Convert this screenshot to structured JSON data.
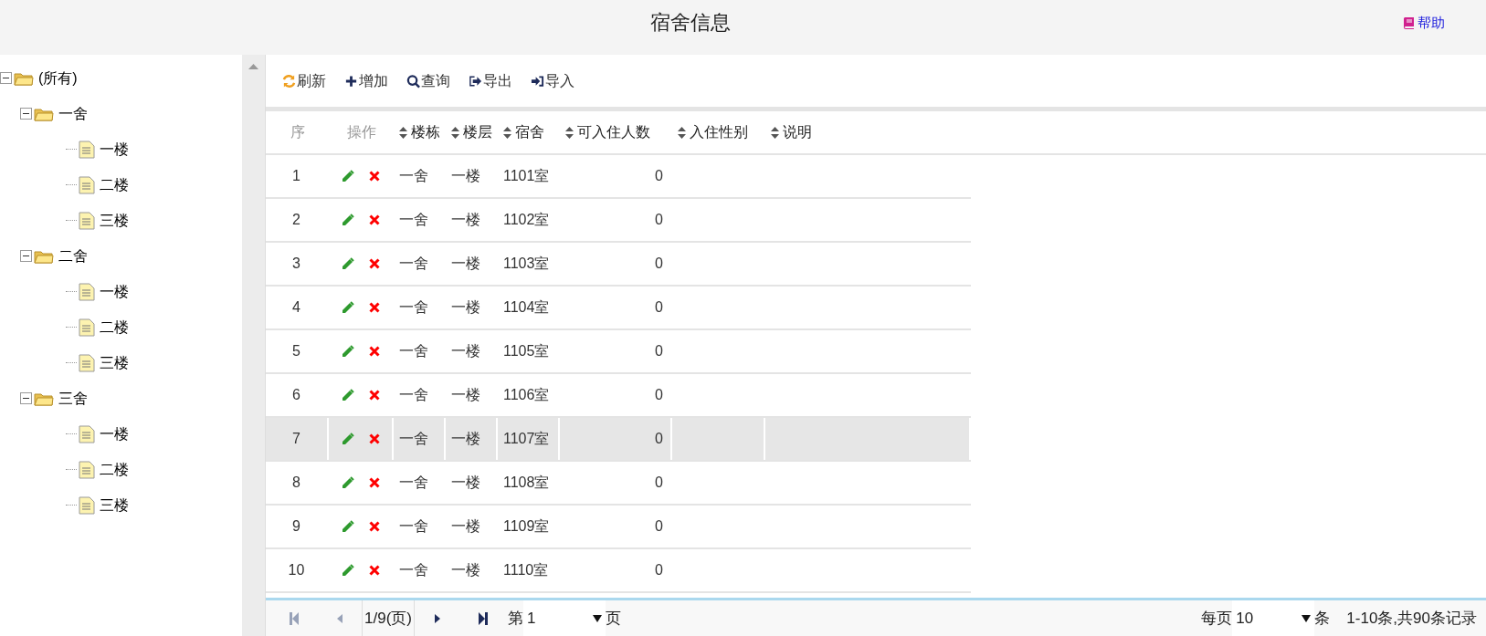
{
  "header": {
    "title": "宿舍信息",
    "help": "帮助"
  },
  "tree": {
    "label": "(所有)",
    "expanded": true,
    "children": [
      {
        "label": "一舍",
        "expanded": true,
        "children": [
          {
            "label": "一楼"
          },
          {
            "label": "二楼"
          },
          {
            "label": "三楼"
          }
        ]
      },
      {
        "label": "二舍",
        "expanded": true,
        "children": [
          {
            "label": "一楼"
          },
          {
            "label": "二楼"
          },
          {
            "label": "三楼"
          }
        ]
      },
      {
        "label": "三舍",
        "expanded": true,
        "children": [
          {
            "label": "一楼"
          },
          {
            "label": "二楼"
          },
          {
            "label": "三楼"
          }
        ]
      }
    ]
  },
  "toolbar": [
    {
      "kind": "refresh",
      "label": "刷新"
    },
    {
      "kind": "add",
      "label": "增加"
    },
    {
      "kind": "search",
      "label": "查询"
    },
    {
      "kind": "export",
      "label": "导出"
    },
    {
      "kind": "import",
      "label": "导入"
    }
  ],
  "table": {
    "columns": [
      {
        "label": "序",
        "sortable": false
      },
      {
        "label": "操作",
        "sortable": false
      },
      {
        "label": "楼栋",
        "sortable": true
      },
      {
        "label": "楼层",
        "sortable": true
      },
      {
        "label": "宿舍",
        "sortable": true
      },
      {
        "label": "可入住人数",
        "sortable": true
      },
      {
        "label": "入住性别",
        "sortable": true
      },
      {
        "label": "说明",
        "sortable": true
      }
    ],
    "rows": [
      {
        "seq": "1",
        "building": "一舍",
        "floor": "一楼",
        "room": "1101室",
        "capacity": "0",
        "selected": false
      },
      {
        "seq": "2",
        "building": "一舍",
        "floor": "一楼",
        "room": "1102室",
        "capacity": "0",
        "selected": false
      },
      {
        "seq": "3",
        "building": "一舍",
        "floor": "一楼",
        "room": "1103室",
        "capacity": "0",
        "selected": false
      },
      {
        "seq": "4",
        "building": "一舍",
        "floor": "一楼",
        "room": "1104室",
        "capacity": "0",
        "selected": false
      },
      {
        "seq": "5",
        "building": "一舍",
        "floor": "一楼",
        "room": "1105室",
        "capacity": "0",
        "selected": false
      },
      {
        "seq": "6",
        "building": "一舍",
        "floor": "一楼",
        "room": "1106室",
        "capacity": "0",
        "selected": false
      },
      {
        "seq": "7",
        "building": "一舍",
        "floor": "一楼",
        "room": "1107室",
        "capacity": "0",
        "selected": true
      },
      {
        "seq": "8",
        "building": "一舍",
        "floor": "一楼",
        "room": "1108室",
        "capacity": "0",
        "selected": false
      },
      {
        "seq": "9",
        "building": "一舍",
        "floor": "一楼",
        "room": "1109室",
        "capacity": "0",
        "selected": false
      },
      {
        "seq": "10",
        "building": "一舍",
        "floor": "一楼",
        "room": "1110室",
        "capacity": "0",
        "selected": false
      }
    ]
  },
  "pager": {
    "first_disabled": true,
    "prev_disabled": true,
    "next_disabled": false,
    "last_disabled": false,
    "page_info": "1/9(页)",
    "page_prefix": "第",
    "page": "1",
    "page_suffix": "页",
    "size_prefix": "每页",
    "size": "10",
    "size_suffix": "条",
    "summary": "1-10条,共90条记录"
  }
}
